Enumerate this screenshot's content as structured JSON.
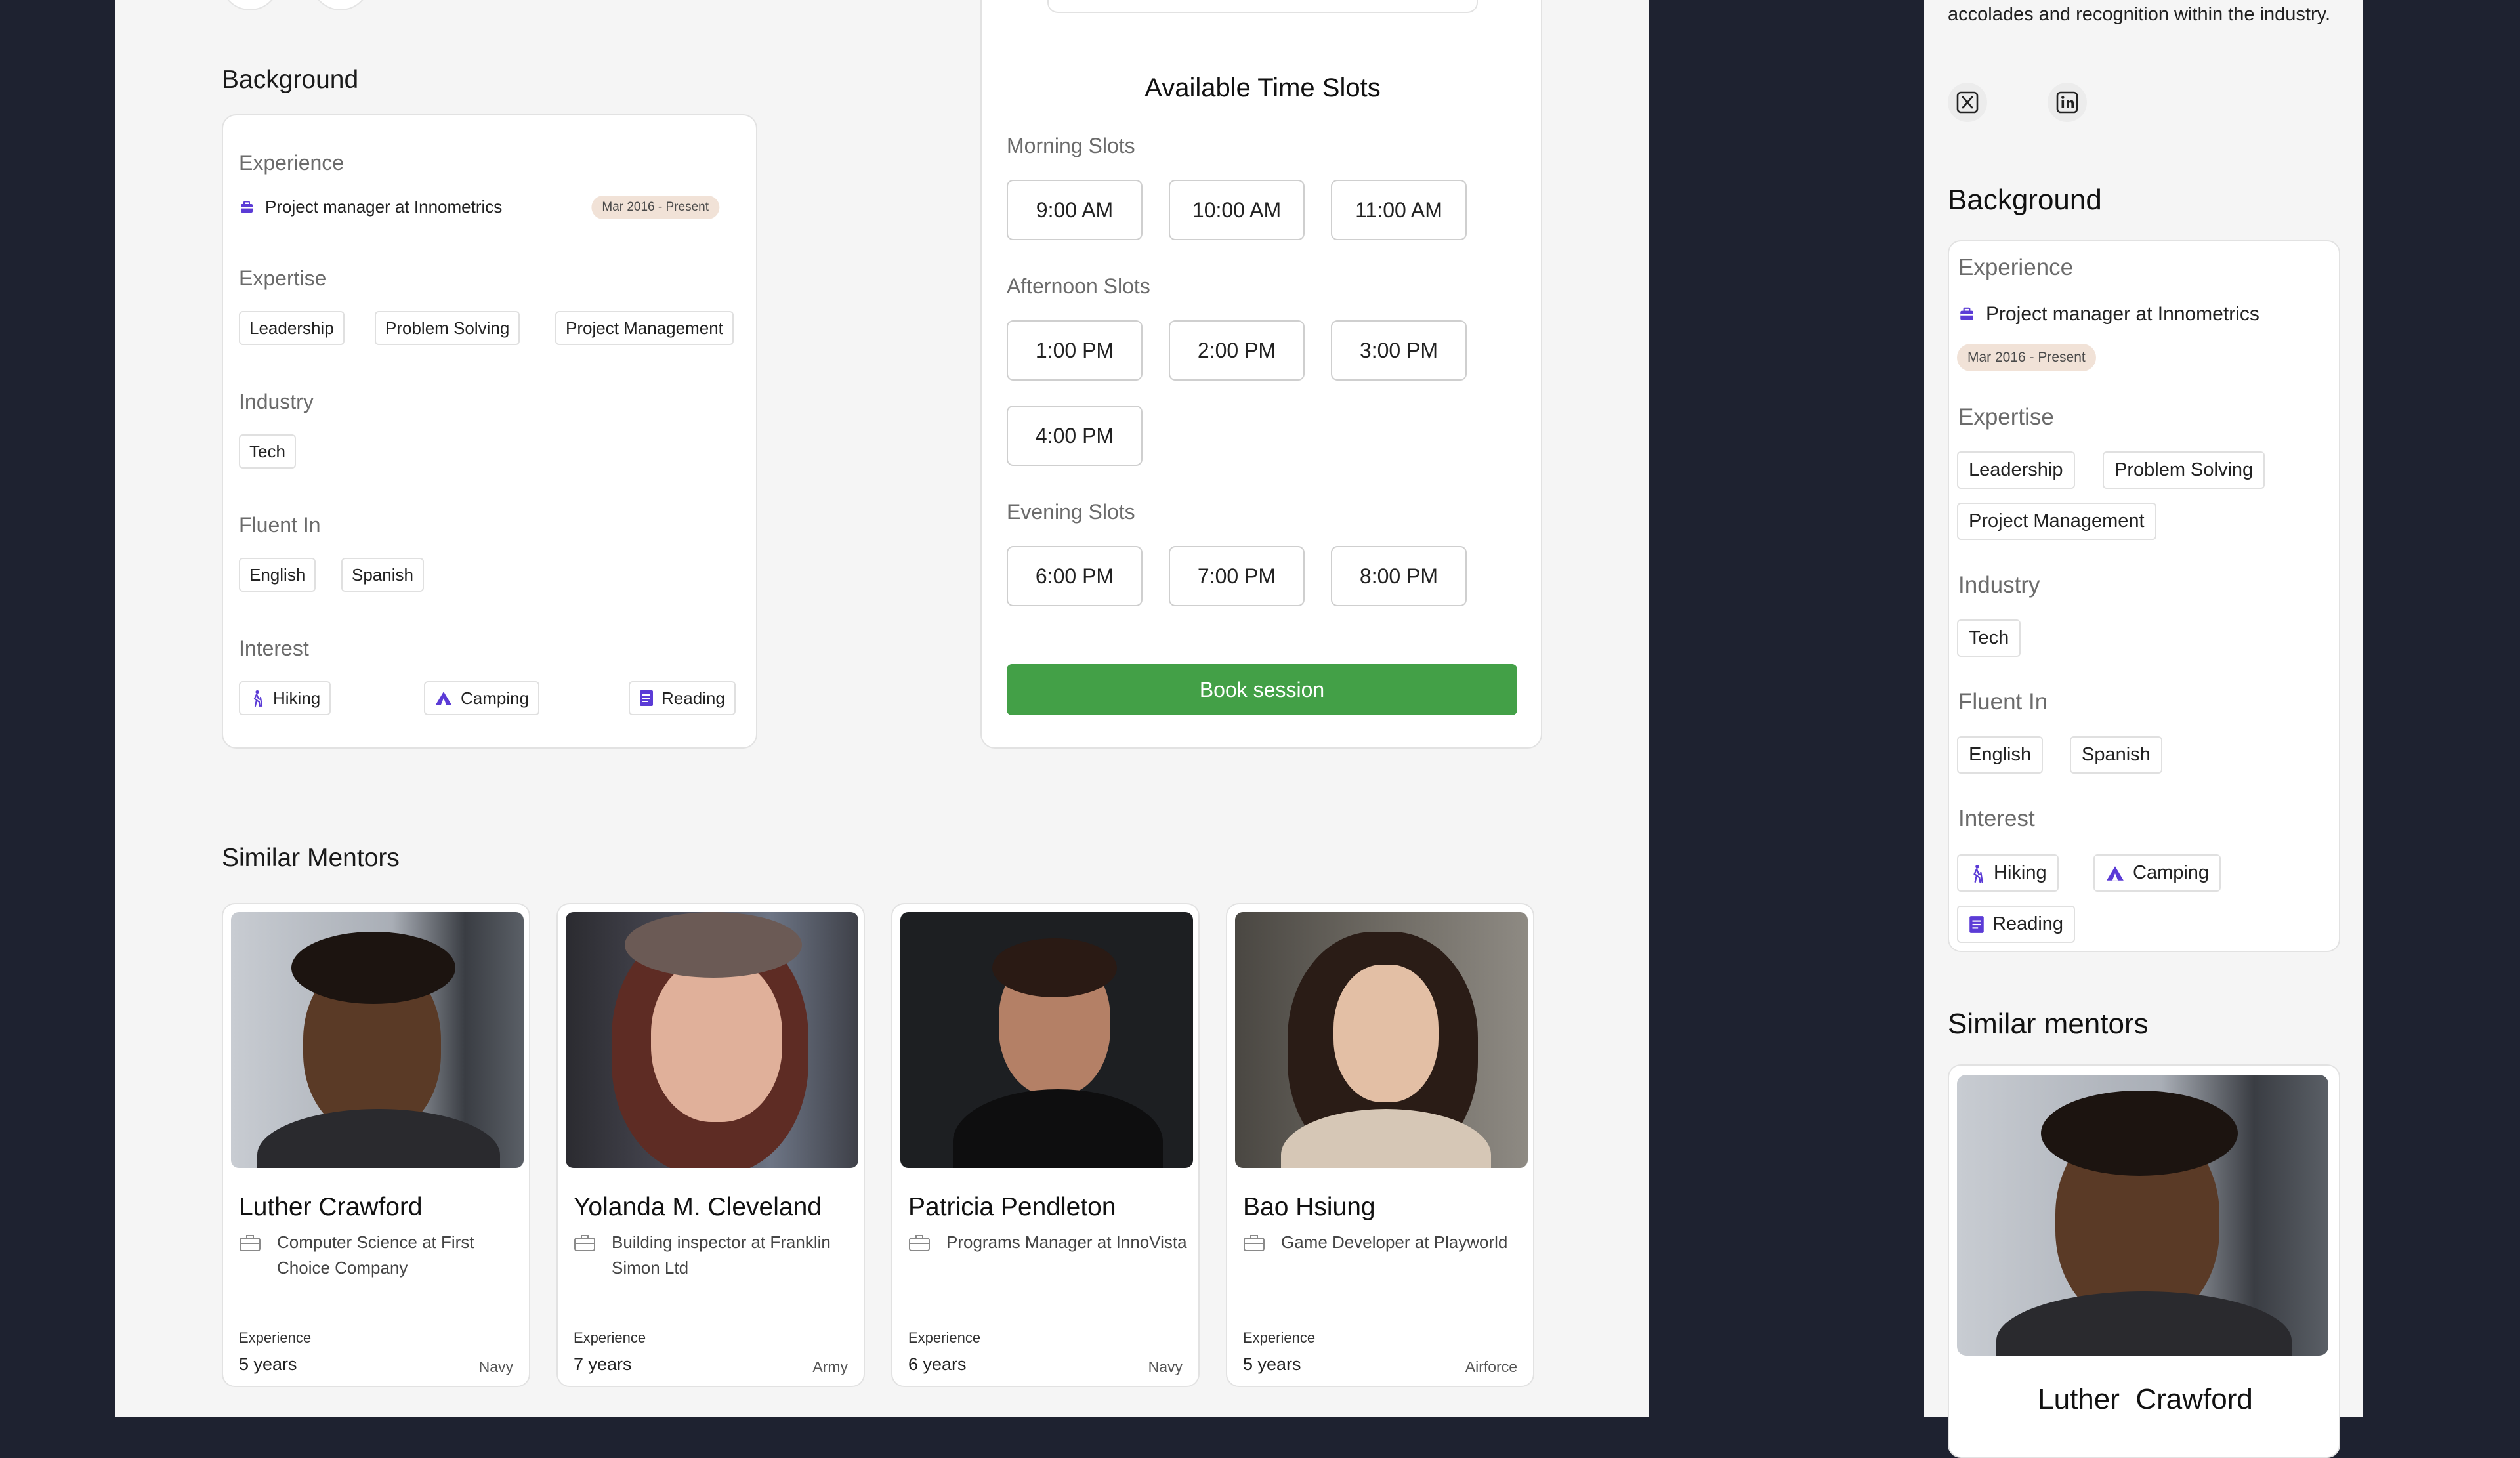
{
  "main": {
    "background": {
      "title": "Background",
      "experience_label": "Experience",
      "experience_item": "Project manager at Innometrics",
      "experience_dates": "Mar 2016 - Present",
      "expertise_label": "Expertise",
      "expertise": [
        "Leadership",
        "Problem Solving",
        "Project Management"
      ],
      "industry_label": "Industry",
      "industry": [
        "Tech"
      ],
      "fluent_label": "Fluent In",
      "languages": [
        "English",
        "Spanish"
      ],
      "interest_label": "Interest",
      "interests": [
        "Hiking",
        "Camping",
        "Reading"
      ]
    },
    "slots": {
      "title": "Available Time Slots",
      "morning_label": "Morning Slots",
      "morning": [
        "9:00 AM",
        "10:00 AM",
        "11:00 AM"
      ],
      "afternoon_label": "Afternoon Slots",
      "afternoon": [
        "1:00 PM",
        "2:00 PM",
        "3:00 PM",
        "4:00 PM"
      ],
      "evening_label": "Evening Slots",
      "evening": [
        "6:00 PM",
        "7:00 PM",
        "8:00 PM"
      ],
      "book_label": "Book session"
    },
    "similar": {
      "title": "Similar Mentors",
      "mentors": [
        {
          "name": "Luther  Crawford",
          "role": "Computer Science at First Choice Company",
          "exp_label": "Experience",
          "years": "5 years",
          "branch": "Navy"
        },
        {
          "name": "Yolanda M. Cleveland",
          "role": "Building inspector at Franklin Simon Ltd",
          "exp_label": "Experience",
          "years": "7 years",
          "branch": "Army"
        },
        {
          "name": "Patricia Pendleton",
          "role": "Programs Manager at InnoVista",
          "exp_label": "Experience",
          "years": "6 years",
          "branch": "Navy"
        },
        {
          "name": "Bao Hsiung",
          "role": "Game Developer at Playworld",
          "exp_label": "Experience",
          "years": "5 years",
          "branch": "Airforce"
        }
      ]
    }
  },
  "side": {
    "bio_tail": "accolades and recognition within the industry.",
    "social": [
      "x-icon",
      "linkedin-icon"
    ],
    "background": {
      "title": "Background",
      "experience_label": "Experience",
      "experience_item": "Project manager at Innometrics",
      "experience_dates": "Mar 2016 - Present",
      "expertise_label": "Expertise",
      "expertise": [
        "Leadership",
        "Problem Solving",
        "Project Management"
      ],
      "industry_label": "Industry",
      "industry": [
        "Tech"
      ],
      "fluent_label": "Fluent In",
      "languages": [
        "English",
        "Spanish"
      ],
      "interest_label": "Interest",
      "interests": [
        "Hiking",
        "Camping",
        "Reading"
      ]
    },
    "similar_title": "Similar mentors",
    "mentor_name": "Luther  Crawford"
  },
  "colors": {
    "accent_green": "#43a047",
    "icon_purple": "#5b3bd6",
    "date_pill": "#f1e2d7",
    "page_dark": "#1e2230"
  }
}
